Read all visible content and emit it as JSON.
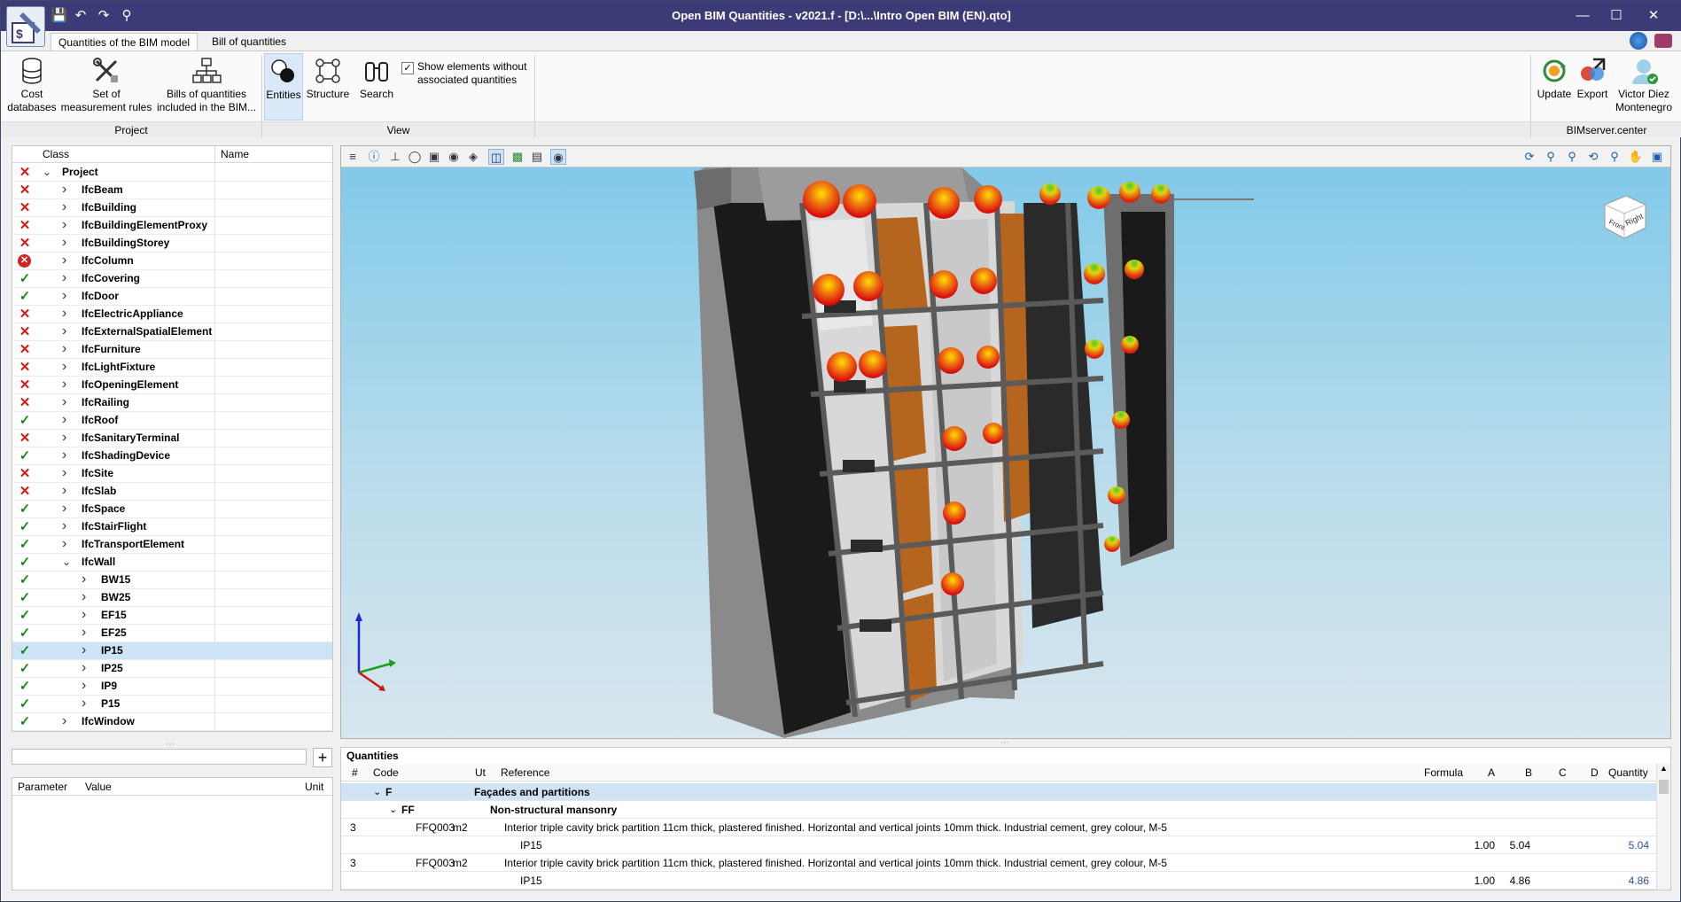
{
  "title": "Open BIM Quantities - v2021.f - [D:\\...\\Intro Open BIM (EN).qto]",
  "tabs": [
    "Quantities of the BIM model",
    "Bill of quantities"
  ],
  "ribbon": {
    "cost_db": "Cost\ndatabases",
    "measure_rules": "Set of\nmeasurement rules",
    "boq_included": "Bills of quantities\nincluded in the BIM...",
    "entities": "Entities",
    "structure": "Structure",
    "search": "Search",
    "show_elements": "Show elements without\nassociated quantities",
    "update": "Update",
    "export": "Export",
    "user": "Victor Diez\nMontenegro",
    "groups": {
      "project": "Project",
      "view": "View",
      "bimserver": "BIMserver.center"
    }
  },
  "tree": {
    "col_class": "Class",
    "col_name": "Name",
    "rows": [
      {
        "s": "x",
        "lvl": 0,
        "open": true,
        "label": "Project"
      },
      {
        "s": "x",
        "lvl": 1,
        "label": "IfcBeam"
      },
      {
        "s": "x",
        "lvl": 1,
        "label": "IfcBuilding"
      },
      {
        "s": "x",
        "lvl": 1,
        "label": "IfcBuildingElementProxy"
      },
      {
        "s": "x",
        "lvl": 1,
        "label": "IfcBuildingStorey"
      },
      {
        "s": "err",
        "lvl": 1,
        "label": "IfcColumn"
      },
      {
        "s": "ok",
        "lvl": 1,
        "label": "IfcCovering"
      },
      {
        "s": "ok",
        "lvl": 1,
        "label": "IfcDoor"
      },
      {
        "s": "x",
        "lvl": 1,
        "label": "IfcElectricAppliance"
      },
      {
        "s": "x",
        "lvl": 1,
        "label": "IfcExternalSpatialElement"
      },
      {
        "s": "x",
        "lvl": 1,
        "label": "IfcFurniture"
      },
      {
        "s": "x",
        "lvl": 1,
        "label": "IfcLightFixture"
      },
      {
        "s": "x",
        "lvl": 1,
        "label": "IfcOpeningElement"
      },
      {
        "s": "x",
        "lvl": 1,
        "label": "IfcRailing"
      },
      {
        "s": "ok",
        "lvl": 1,
        "label": "IfcRoof"
      },
      {
        "s": "x",
        "lvl": 1,
        "label": "IfcSanitaryTerminal"
      },
      {
        "s": "ok",
        "lvl": 1,
        "label": "IfcShadingDevice"
      },
      {
        "s": "x",
        "lvl": 1,
        "label": "IfcSite"
      },
      {
        "s": "x",
        "lvl": 1,
        "label": "IfcSlab"
      },
      {
        "s": "ok",
        "lvl": 1,
        "label": "IfcSpace"
      },
      {
        "s": "ok",
        "lvl": 1,
        "label": "IfcStairFlight"
      },
      {
        "s": "ok",
        "lvl": 1,
        "label": "IfcTransportElement"
      },
      {
        "s": "ok",
        "lvl": 1,
        "open": true,
        "label": "IfcWall"
      },
      {
        "s": "ok",
        "lvl": 2,
        "label": "BW15"
      },
      {
        "s": "ok",
        "lvl": 2,
        "label": "BW25"
      },
      {
        "s": "ok",
        "lvl": 2,
        "label": "EF15"
      },
      {
        "s": "ok",
        "lvl": 2,
        "label": "EF25"
      },
      {
        "s": "ok",
        "lvl": 2,
        "label": "IP15",
        "sel": true
      },
      {
        "s": "ok",
        "lvl": 2,
        "label": "IP25"
      },
      {
        "s": "ok",
        "lvl": 2,
        "label": "IP9"
      },
      {
        "s": "ok",
        "lvl": 2,
        "label": "P15"
      },
      {
        "s": "ok",
        "lvl": 1,
        "label": "IfcWindow"
      }
    ]
  },
  "params": {
    "col_parameter": "Parameter",
    "col_value": "Value",
    "col_unit": "Unit"
  },
  "quantities": {
    "title": "Quantities",
    "cols": {
      "n": "#",
      "code": "Code",
      "ut": "Ut",
      "ref": "Reference",
      "formula": "Formula",
      "a": "A",
      "b": "B",
      "c": "C",
      "d": "D",
      "qty": "Quantity"
    },
    "rows": [
      {
        "type": "chapter",
        "code": "F",
        "ref": "Façades and partitions"
      },
      {
        "type": "sub",
        "code": "FF",
        "ref": "Non-structural mansonry"
      },
      {
        "type": "item",
        "n": "3",
        "code": "FFQ003",
        "ut": "m2",
        "ref": "Interior triple cavity brick partition 11cm thick, plastered finished. Horizontal and vertical joints 10mm thick. Industrial cement, grey colour, M-5"
      },
      {
        "type": "line",
        "ref": "IP15",
        "a": "1.00",
        "b": "5.04",
        "qty": "5.04"
      },
      {
        "type": "item",
        "n": "3",
        "code": "FFQ003",
        "ut": "m2",
        "ref": "Interior triple cavity brick partition 11cm thick, plastered finished. Horizontal and vertical joints 10mm thick. Industrial cement, grey colour, M-5"
      },
      {
        "type": "line",
        "ref": "IP15",
        "a": "1.00",
        "b": "4.86",
        "qty": "4.86"
      }
    ]
  },
  "viewcube": {
    "front": "Front",
    "right": "Right"
  }
}
